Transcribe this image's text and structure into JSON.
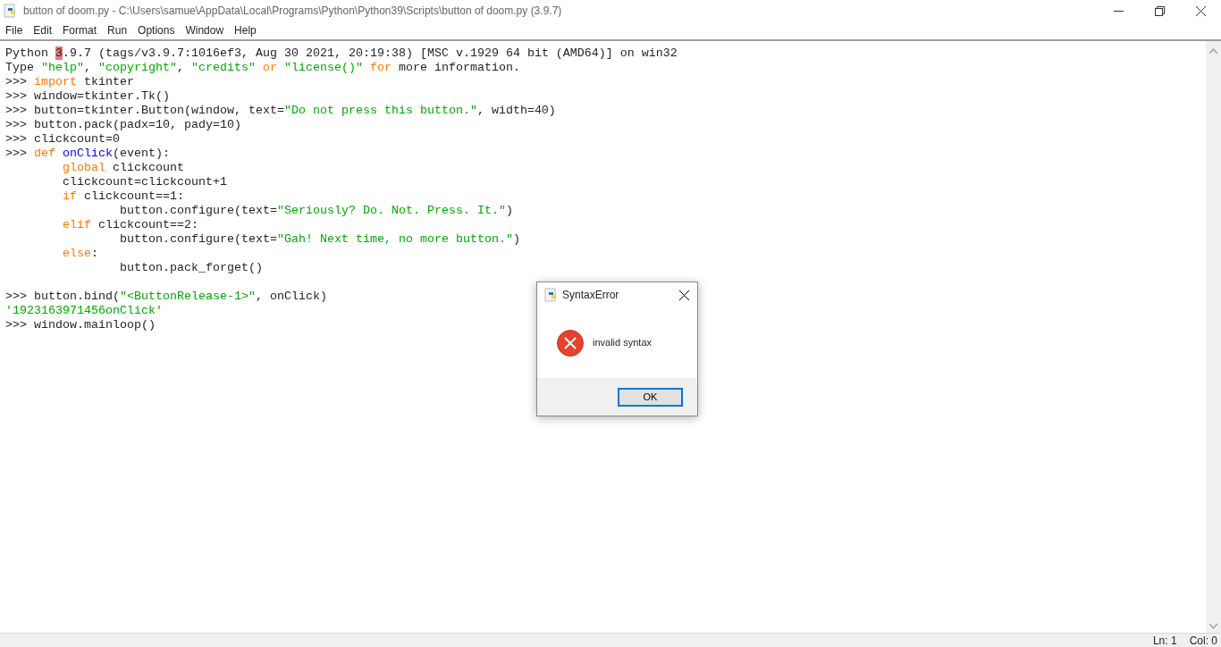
{
  "window": {
    "title": "button of doom.py - C:\\Users\\samue\\AppData\\Local\\Programs\\Python\\Python39\\Scripts\\button of doom.py (3.9.7)"
  },
  "menu": [
    "File",
    "Edit",
    "Format",
    "Run",
    "Options",
    "Window",
    "Help"
  ],
  "shell": {
    "lines": [
      {
        "tokens": [
          {
            "kind": "plain",
            "text": "Python "
          },
          {
            "kind": "cursor",
            "text": "3"
          },
          {
            "kind": "plain",
            "text": ".9.7 (tags/v3.9.7:1016ef3, Aug 30 2021, 20:19:38) [MSC v.1929 64 bit (AMD64)] on win32"
          }
        ]
      },
      {
        "tokens": [
          {
            "kind": "plain",
            "text": "Type "
          },
          {
            "kind": "string",
            "text": "\"help\""
          },
          {
            "kind": "plain",
            "text": ", "
          },
          {
            "kind": "string",
            "text": "\"copyright\""
          },
          {
            "kind": "plain",
            "text": ", "
          },
          {
            "kind": "string",
            "text": "\"credits\""
          },
          {
            "kind": "keyword",
            "text": " or "
          },
          {
            "kind": "string",
            "text": "\"license()\""
          },
          {
            "kind": "keyword",
            "text": " for"
          },
          {
            "kind": "plain",
            "text": " more information."
          }
        ]
      },
      {
        "tokens": [
          {
            "kind": "plain",
            "text": ">>> "
          },
          {
            "kind": "keyword",
            "text": "import"
          },
          {
            "kind": "plain",
            "text": " tkinter"
          }
        ]
      },
      {
        "tokens": [
          {
            "kind": "plain",
            "text": ">>> window=tkinter.Tk()"
          }
        ]
      },
      {
        "tokens": [
          {
            "kind": "plain",
            "text": ">>> button=tkinter.Button(window, text="
          },
          {
            "kind": "string",
            "text": "\"Do not press this button.\""
          },
          {
            "kind": "plain",
            "text": ", width=40)"
          }
        ]
      },
      {
        "tokens": [
          {
            "kind": "plain",
            "text": ">>> button.pack(padx=10, pady=10)"
          }
        ]
      },
      {
        "tokens": [
          {
            "kind": "plain",
            "text": ">>> clickcount=0"
          }
        ]
      },
      {
        "tokens": [
          {
            "kind": "plain",
            "text": ">>> "
          },
          {
            "kind": "keyword",
            "text": "def "
          },
          {
            "kind": "definition",
            "text": "onClick"
          },
          {
            "kind": "plain",
            "text": "(event):"
          }
        ]
      },
      {
        "tokens": [
          {
            "kind": "keyword",
            "text": "\tglobal"
          },
          {
            "kind": "plain",
            "text": " clickcount"
          }
        ]
      },
      {
        "tokens": [
          {
            "kind": "plain",
            "text": "\tclickcount=clickcount+1"
          }
        ]
      },
      {
        "tokens": [
          {
            "kind": "keyword",
            "text": "\tif"
          },
          {
            "kind": "plain",
            "text": " clickcount==1:"
          }
        ]
      },
      {
        "tokens": [
          {
            "kind": "plain",
            "text": "\t\tbutton.configure(text="
          },
          {
            "kind": "string",
            "text": "\"Seriously? Do. Not. Press. It.\""
          },
          {
            "kind": "plain",
            "text": ")"
          }
        ]
      },
      {
        "tokens": [
          {
            "kind": "keyword",
            "text": "\telif"
          },
          {
            "kind": "plain",
            "text": " clickcount==2:"
          }
        ]
      },
      {
        "tokens": [
          {
            "kind": "plain",
            "text": "\t\tbutton.configure(text="
          },
          {
            "kind": "string",
            "text": "\"Gah! Next time, no more button.\""
          },
          {
            "kind": "plain",
            "text": ")"
          }
        ]
      },
      {
        "tokens": [
          {
            "kind": "keyword",
            "text": "\telse"
          },
          {
            "kind": "plain",
            "text": ":"
          }
        ]
      },
      {
        "tokens": [
          {
            "kind": "plain",
            "text": "\t\tbutton.pack_forget()"
          }
        ]
      },
      {
        "kind": "blank"
      },
      {
        "tokens": [
          {
            "kind": "plain",
            "text": ">>> button.bind("
          },
          {
            "kind": "string",
            "text": "\"<ButtonRelease-1>\""
          },
          {
            "kind": "plain",
            "text": ", onClick)"
          }
        ]
      },
      {
        "tokens": [
          {
            "kind": "string",
            "text": "'1923163971456onClick'"
          }
        ]
      },
      {
        "tokens": [
          {
            "kind": "plain",
            "text": ">>> window.mainloop()"
          }
        ]
      }
    ]
  },
  "dialog": {
    "title": "SyntaxError",
    "message": "invalid syntax",
    "button": "OK"
  },
  "status_bar": {
    "line": "Ln: 1",
    "column": "Col: 0"
  }
}
